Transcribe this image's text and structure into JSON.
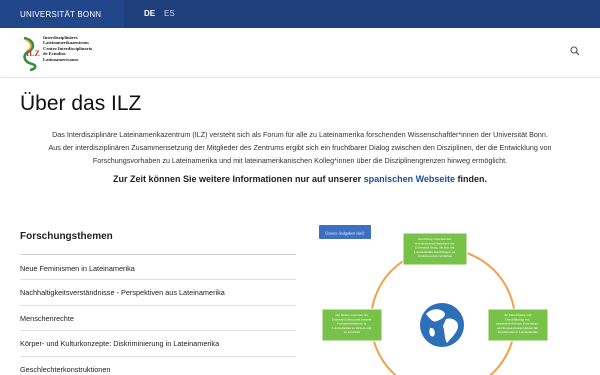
{
  "topbar": {
    "university": "UNIVERSITÄT BONN",
    "languages": [
      {
        "code": "DE",
        "active": true
      },
      {
        "code": "ES",
        "active": false
      }
    ]
  },
  "header": {
    "logo_lines": [
      "Interdisziplinäres",
      "Lateinamerikazentrum",
      "Centro Interdisciplinario",
      "de Estudios",
      "Latinoamericanos"
    ],
    "search_icon": "search-icon"
  },
  "main": {
    "title": "Über das ILZ",
    "intro_lines": [
      "Das Interdisziplinäre Lateinamerikazentrum (ILZ) versteht sich als Forum für alle zu Lateinamerika forschenden Wissenschaftler*innen der Universität Bonn.",
      "Aus der interdisziplinären Zusammensetzung der Mitglieder des Zentrums ergibt sich ein fruchtbarer Dialog zwischen den Disziplinen, der die Entwicklung von",
      "Forschungsvorhaben zu Lateinamerika und mit lateinamerikanischen Kolleg*innen über die Disziplinengrenzen hinweg ermöglicht."
    ],
    "notice_before": "Zur Zeit können Sie weitere Informationen nur auf unserer ",
    "notice_link": "spanischen Webseite",
    "notice_after": " finden."
  },
  "topics": {
    "title": "Forschungsthemen",
    "items": [
      "Neue Feminismen in Lateinamerika",
      "Nachhaltigkeitsverständnisse - Perspektiven aus Lateinamerika",
      "Menschenrechte",
      "Körper- und Kulturkonzepte: Diskriminierung in Lateinamerika",
      "Geschlechterkonstruktionen"
    ]
  },
  "diagram": {
    "label": "Unsere Aufgaben sind:",
    "colors": {
      "label_bg": "#3d6fc4",
      "box": "#79c24a",
      "ring": "#f0a14a",
      "globe": "#2d6fb8"
    },
    "boxes": [
      [
        "den Dialog zwischen den",
        "verschiedenen Disziplinen der",
        "Universität Bonn, die sich mit",
        "Lateinamerika beschäftigen, zu",
        "fördern und zu verstärken"
      ],
      [
        "die Entwicklung und",
        "Durchführung von",
        "gemeinschaftlichen Forschungs-",
        "und Kooperationsprojekten mit",
        "Institutionen in Lateinamerika"
      ],
      [
        "den Dialog zwischen der",
        "Universität Bonn und unseren",
        "Partnerinstitutionen in",
        "Lateinamerika zu fördern und",
        "zu erweitern"
      ]
    ]
  }
}
